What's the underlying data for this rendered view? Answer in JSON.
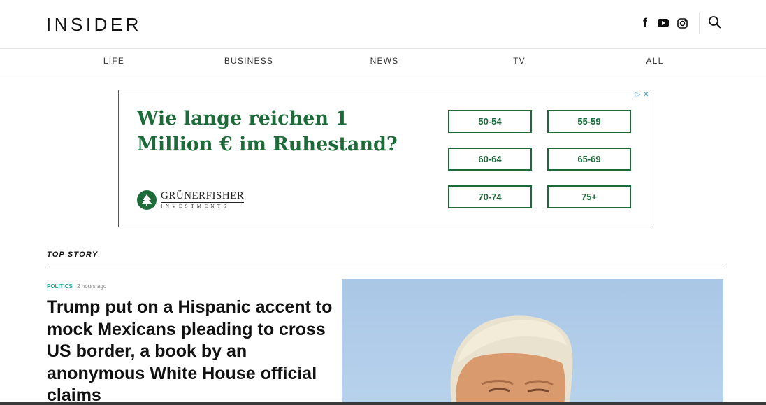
{
  "header": {
    "logo": "INSIDER",
    "social": [
      "facebook-icon",
      "youtube-icon",
      "instagram-icon"
    ],
    "search_icon": "search-icon"
  },
  "nav": {
    "items": [
      "LIFE",
      "BUSINESS",
      "NEWS",
      "TV",
      "ALL"
    ]
  },
  "ad": {
    "headline": "Wie lange reichen 1 Million € im Ruhestand?",
    "buttons": [
      "50-54",
      "55-59",
      "60-64",
      "65-69",
      "70-74",
      "75+"
    ],
    "brand_name": "GRÜNERFISHER",
    "brand_sub": "INVESTMENTS",
    "accent": "#1e6b3a"
  },
  "section": {
    "label": "TOP STORY"
  },
  "story": {
    "category": "POLITICS",
    "time": "2 hours ago",
    "headline": "Trump put on a Hispanic accent to mock Mexicans pleading to cross US border, a book by an anonymous White House official claims",
    "category_color": "#1aa99a"
  }
}
